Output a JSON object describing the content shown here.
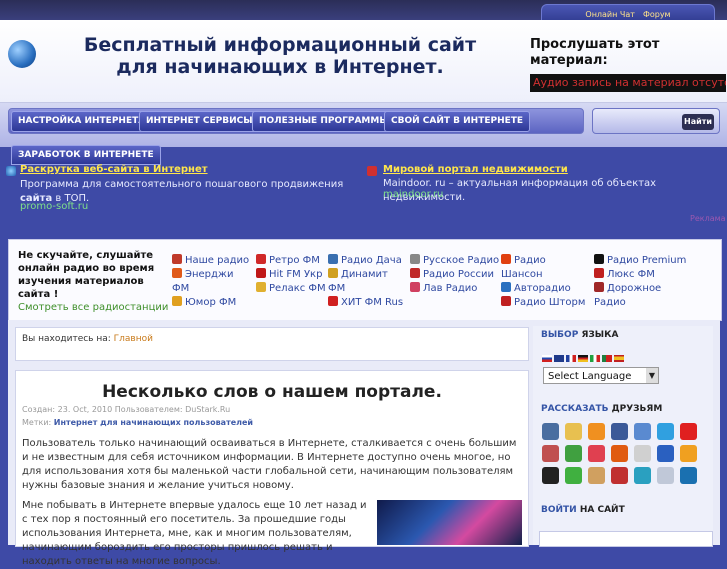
{
  "top_nav": {
    "chat": "Онлайн Чат",
    "forum": "Форум"
  },
  "header": {
    "title": "Бесплатный информационный сайт для начинающих в Интернет.",
    "listen_title": "Прослушать этот материал:",
    "audio_message": "Аудио запись на материал отсутствует."
  },
  "nav": {
    "items": [
      "НАСТРОЙКА ИНТЕРНЕТА",
      "ИНТЕРНЕТ СЕРВИСЫ",
      "ПОЛЕЗНЫЕ ПРОГРАММЫ",
      "СВОЙ САЙТ В ИНТЕРНЕТЕ"
    ],
    "earn": "ЗАРАБОТОК В ИНТЕРНЕТЕ",
    "search_button": "Найти"
  },
  "ads": [
    {
      "title": "Раскрутка веб-сайта в Интернет",
      "body_pre": "Программа для самостоятельного пошагового продвижения ",
      "body_bold": "сайта",
      "body_post": " в ТОП.",
      "url": "promo-soft.ru"
    },
    {
      "title": "Мировой портал недвижимости",
      "body_pre": "Maindoor. ru – актуальная информация об объектах недвижимости.",
      "body_bold": "",
      "body_post": "",
      "url": "maindoor.ru"
    }
  ],
  "ad_more": "Реклама",
  "radio": {
    "intro": "Не скучайте, слушайте онлайн радио во время изучения материалов сайта !",
    "see_all": "Смотреть все радиостанции",
    "stations": [
      [
        "Наше радио",
        "Энерджи ФМ",
        "Юмор ФМ"
      ],
      [
        "Ретро ФМ",
        "Hit FM Укр",
        "Релакс ФМ"
      ],
      [
        "Радио Дача",
        "Динамит ФМ",
        "ХИТ ФМ Rus"
      ],
      [
        "Русское Радио",
        "Радио России",
        "Лав Радио"
      ],
      [
        "Радио Шансон",
        "Авторадио",
        "Радио Шторм"
      ],
      [
        "Радио Premium",
        "Люкс ФМ",
        "Дорожное Радио"
      ]
    ]
  },
  "breadcrumb": {
    "prefix": "Вы находитесь на:",
    "link": "Главной"
  },
  "article": {
    "title": "Несколько слов о нашем портале.",
    "meta": "Создан: 23. Oct, 2010 Пользователем: DuStark.Ru",
    "tags_label": "Метки:",
    "tags": "Интернет для начинающих пользователей",
    "p1": "Пользователь только начинающий осваиваться в Интернете, сталкивается с очень большим и не известным для себя источником информации. В Интернете доступно очень многое, но для использования хотя бы маленькой части глобальной сети, начинающим пользователям нужны базовые знания и желание учиться новому.",
    "p2": "Мне побывать в Интернете впервые удалось еще 10 лет назад и с тех пор я постоянный его посетитель. За прошедшие годы использования Интернета, мне, как и многим пользователям, начинающим бороздить его просторы пришлось решать и находить ответы на многие вопросы."
  },
  "sidebar": {
    "lang_head_a": "ВЫБОР",
    "lang_head_b": "ЯЗЫКА",
    "lang_select": "Select Language",
    "share_head_a": "РАССКАЗАТЬ",
    "share_head_b": "ДРУЗЬЯМ",
    "login_head_a": "ВОЙТИ",
    "login_head_b": "НА САЙТ"
  },
  "colors": {
    "accent": "#3e4aa6",
    "nav": "#2d3796",
    "ad_title": "#ffe64a",
    "link": "#2e48a0"
  }
}
